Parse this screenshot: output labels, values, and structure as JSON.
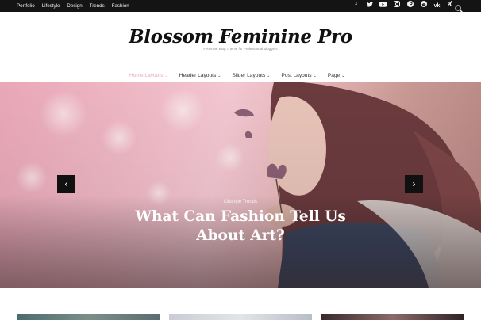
{
  "topbar": {
    "nav": [
      "Portfolio",
      "Lifestyle",
      "Design",
      "Trends",
      "Fashion"
    ],
    "social_icons": [
      "facebook-icon",
      "twitter-icon",
      "youtube-icon",
      "instagram-icon",
      "pinterest-icon",
      "reddit-icon",
      "vk-icon",
      "xing-icon"
    ],
    "search_icon": "search-icon",
    "background": "#141414"
  },
  "header": {
    "title": "Blossom Feminine Pro",
    "tagline": "Feminine Blog Theme for Professional Bloggers"
  },
  "main_nav": {
    "items": [
      {
        "label": "Home Layouts",
        "active": true
      },
      {
        "label": "Header Layouts",
        "active": false
      },
      {
        "label": "Slider Layouts",
        "active": false
      },
      {
        "label": "Post Layouts",
        "active": false
      },
      {
        "label": "Page",
        "active": false
      }
    ],
    "accent_color": "#e9a6bd"
  },
  "slider": {
    "category": "Lifestyle Trends",
    "headline": "What Can Fashion Tell Us About Art?",
    "prev_icon": "chevron-left-icon",
    "next_icon": "chevron-right-icon"
  }
}
